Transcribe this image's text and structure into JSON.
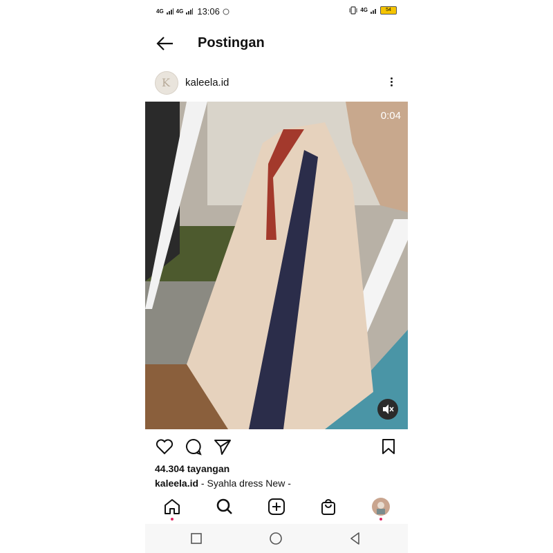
{
  "status_bar": {
    "signal1": "4G",
    "signal2": "4G",
    "time": "13:06",
    "net": "4G",
    "battery": "54"
  },
  "header": {
    "title": "Postingan"
  },
  "post": {
    "username": "kaleela.id",
    "video_time": "0:04",
    "views": "44.304 tayangan",
    "caption_user": "kaleela.id",
    "caption_text": " - Syahla dress New -"
  },
  "icons": {
    "back": "arrow-left-icon",
    "more": "more-vertical-icon",
    "like": "heart-icon",
    "comment": "comment-icon",
    "share": "send-icon",
    "save": "bookmark-icon",
    "mute": "speaker-muted-icon",
    "home": "home-icon",
    "search": "search-icon",
    "add": "plus-square-icon",
    "shop": "shopping-bag-icon",
    "profile": "profile-avatar"
  },
  "colors": {
    "notification_dot": "#e0245e",
    "battery": "#f5c400"
  }
}
